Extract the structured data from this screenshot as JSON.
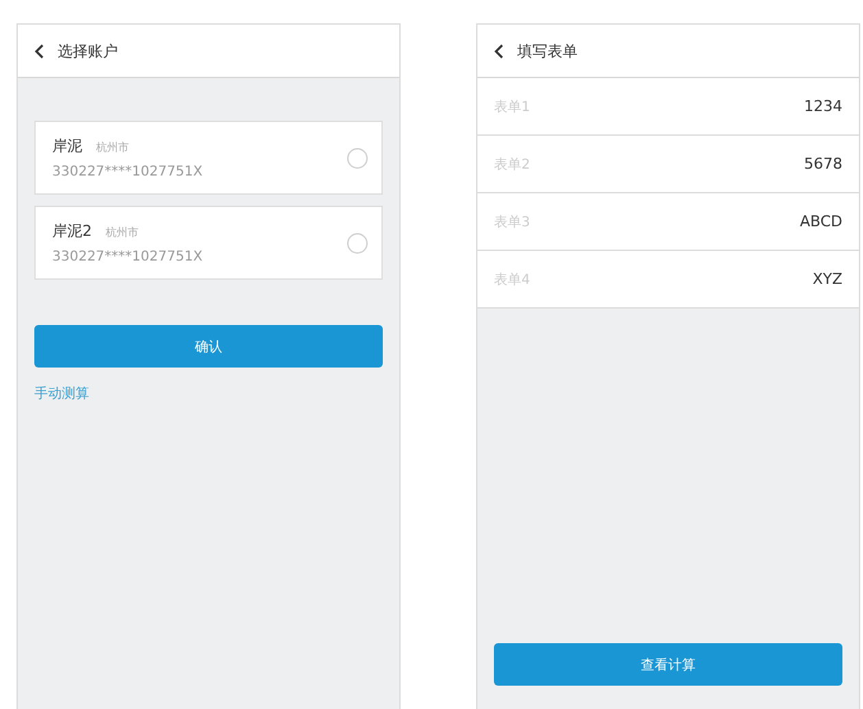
{
  "screens": [
    {
      "kind": "accounts",
      "title": "选择账户",
      "accounts": [
        {
          "name": "岸泥",
          "city": "杭州市",
          "id_number": "330227****1027751X",
          "selected": false
        },
        {
          "name": "岸泥2",
          "city": "杭州市",
          "id_number": "330227****1027751X",
          "selected": false
        }
      ],
      "confirm_button": "确认",
      "manual_link": "手动测算"
    },
    {
      "kind": "form",
      "title": "填写表单",
      "fields": [
        {
          "label": "表单1",
          "value": "1234"
        },
        {
          "label": "表单2",
          "value": "5678"
        },
        {
          "label": "表单3",
          "value": "ABCD"
        },
        {
          "label": "表单4",
          "value": "XYZ"
        }
      ],
      "submit_button": "查看计算"
    }
  ]
}
